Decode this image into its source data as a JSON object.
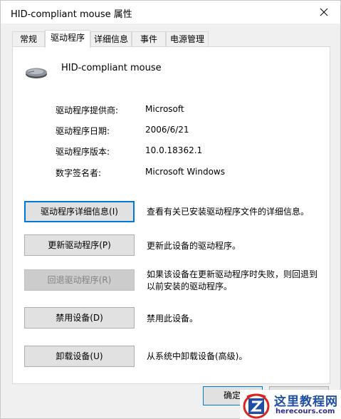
{
  "window": {
    "title": "HID-compliant mouse 属性"
  },
  "tabs": [
    {
      "label": "常规",
      "active": false
    },
    {
      "label": "驱动程序",
      "active": true
    },
    {
      "label": "详细信息",
      "active": false
    },
    {
      "label": "事件",
      "active": false
    },
    {
      "label": "电源管理",
      "active": false
    }
  ],
  "device": {
    "name": "HID-compliant mouse",
    "icon": "mouse-icon"
  },
  "driver_info": [
    {
      "label": "驱动程序提供商:",
      "value": "Microsoft"
    },
    {
      "label": "驱动程序日期:",
      "value": "2006/6/21"
    },
    {
      "label": "驱动程序版本:",
      "value": "10.0.18362.1"
    },
    {
      "label": "数字签名者:",
      "value": "Microsoft Windows"
    }
  ],
  "actions": [
    {
      "label": "驱动程序详细信息(I)",
      "description": "查看有关已安装驱动程序文件的详细信息。",
      "enabled": true,
      "focused": true
    },
    {
      "label": "更新驱动程序(P)",
      "description": "更新此设备的驱动程序。",
      "enabled": true,
      "focused": false
    },
    {
      "label": "回退驱动程序(R)",
      "description": "如果该设备在更新驱动程序时失败，则回退到以前安装的驱动程序。",
      "enabled": false,
      "focused": false
    },
    {
      "label": "禁用设备(D)",
      "description": "禁用此设备。",
      "enabled": true,
      "focused": false
    },
    {
      "label": "卸载设备(U)",
      "description": "从系统中卸载设备(高级)。",
      "enabled": true,
      "focused": false
    }
  ],
  "footer": {
    "ok_label": "确定"
  },
  "watermark": {
    "title": "这里教程网",
    "url": "herecours.com"
  },
  "colors": {
    "accent": "#0078d7",
    "watermark_blue": "#1f4fa3",
    "watermark_red": "#d9261c"
  }
}
